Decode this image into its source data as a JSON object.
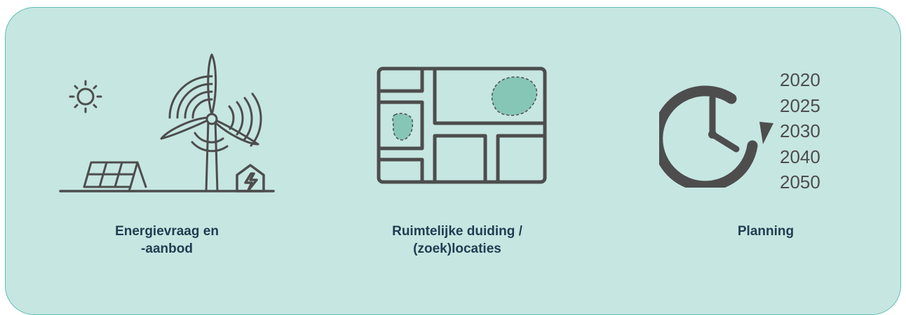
{
  "colors": {
    "panel_bg": "#c6e6e1",
    "panel_border": "#5cc0b4",
    "icon_stroke": "#4d4d4d",
    "accent_fill": "#86c6b6",
    "caption_text": "#1f3d52"
  },
  "items": [
    {
      "icon": "wind-solar-energy-icon",
      "caption_lines": [
        "Energievraag en",
        "-aanbod"
      ]
    },
    {
      "icon": "map-locations-icon",
      "caption_lines": [
        "Ruimtelijke duiding /",
        "(zoek)locaties"
      ]
    },
    {
      "icon": "clock-planning-icon",
      "caption_lines": [
        "Planning"
      ],
      "years": [
        "2020",
        "2025",
        "2030",
        "2040",
        "2050"
      ]
    }
  ]
}
